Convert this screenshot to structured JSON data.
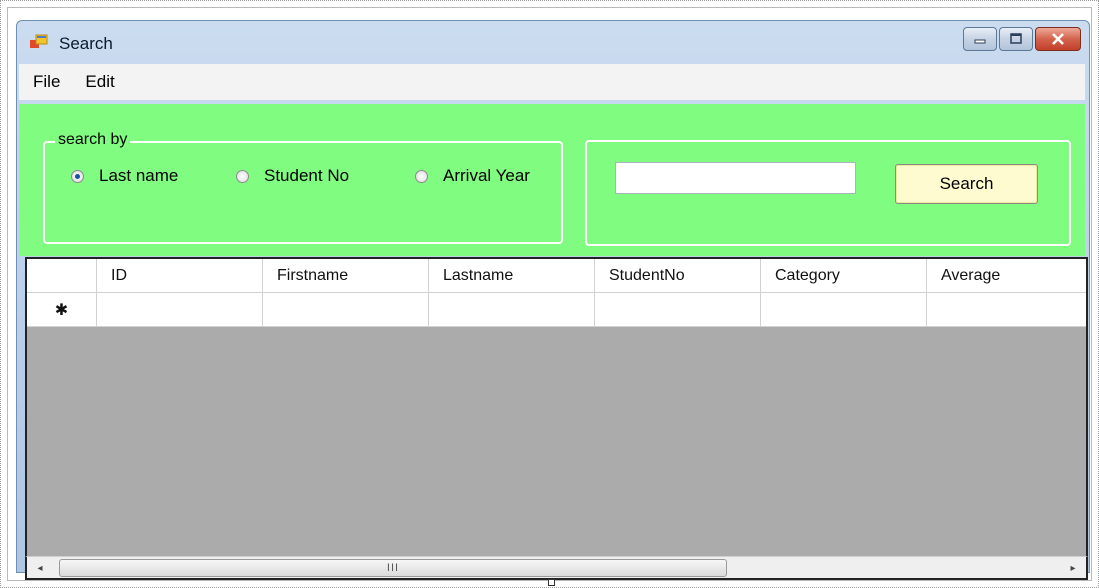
{
  "window": {
    "title": "Search",
    "icon": "app-form-icon",
    "controls": [
      "minimize-icon",
      "maximize-icon",
      "close-icon"
    ]
  },
  "menu": {
    "items": [
      {
        "label": "File"
      },
      {
        "label": "Edit"
      }
    ]
  },
  "search_by": {
    "legend": "search by",
    "options": [
      {
        "label": "Last name",
        "checked": true
      },
      {
        "label": "Student No",
        "checked": false
      },
      {
        "label": "Arrival Year",
        "checked": false
      }
    ]
  },
  "search": {
    "input_value": "",
    "button_label": "Search"
  },
  "grid": {
    "columns": [
      "ID",
      "Firstname",
      "Lastname",
      "StudentNo",
      "Category",
      "Average"
    ],
    "new_row_marker": "✱"
  },
  "scrollbar": {
    "left_arrow": "◂",
    "right_arrow": "▸",
    "thumb_grip": "III"
  },
  "colors": {
    "panel_background": "#80fc80",
    "grid_background": "#ababab",
    "search_button": "#fffbd0"
  }
}
